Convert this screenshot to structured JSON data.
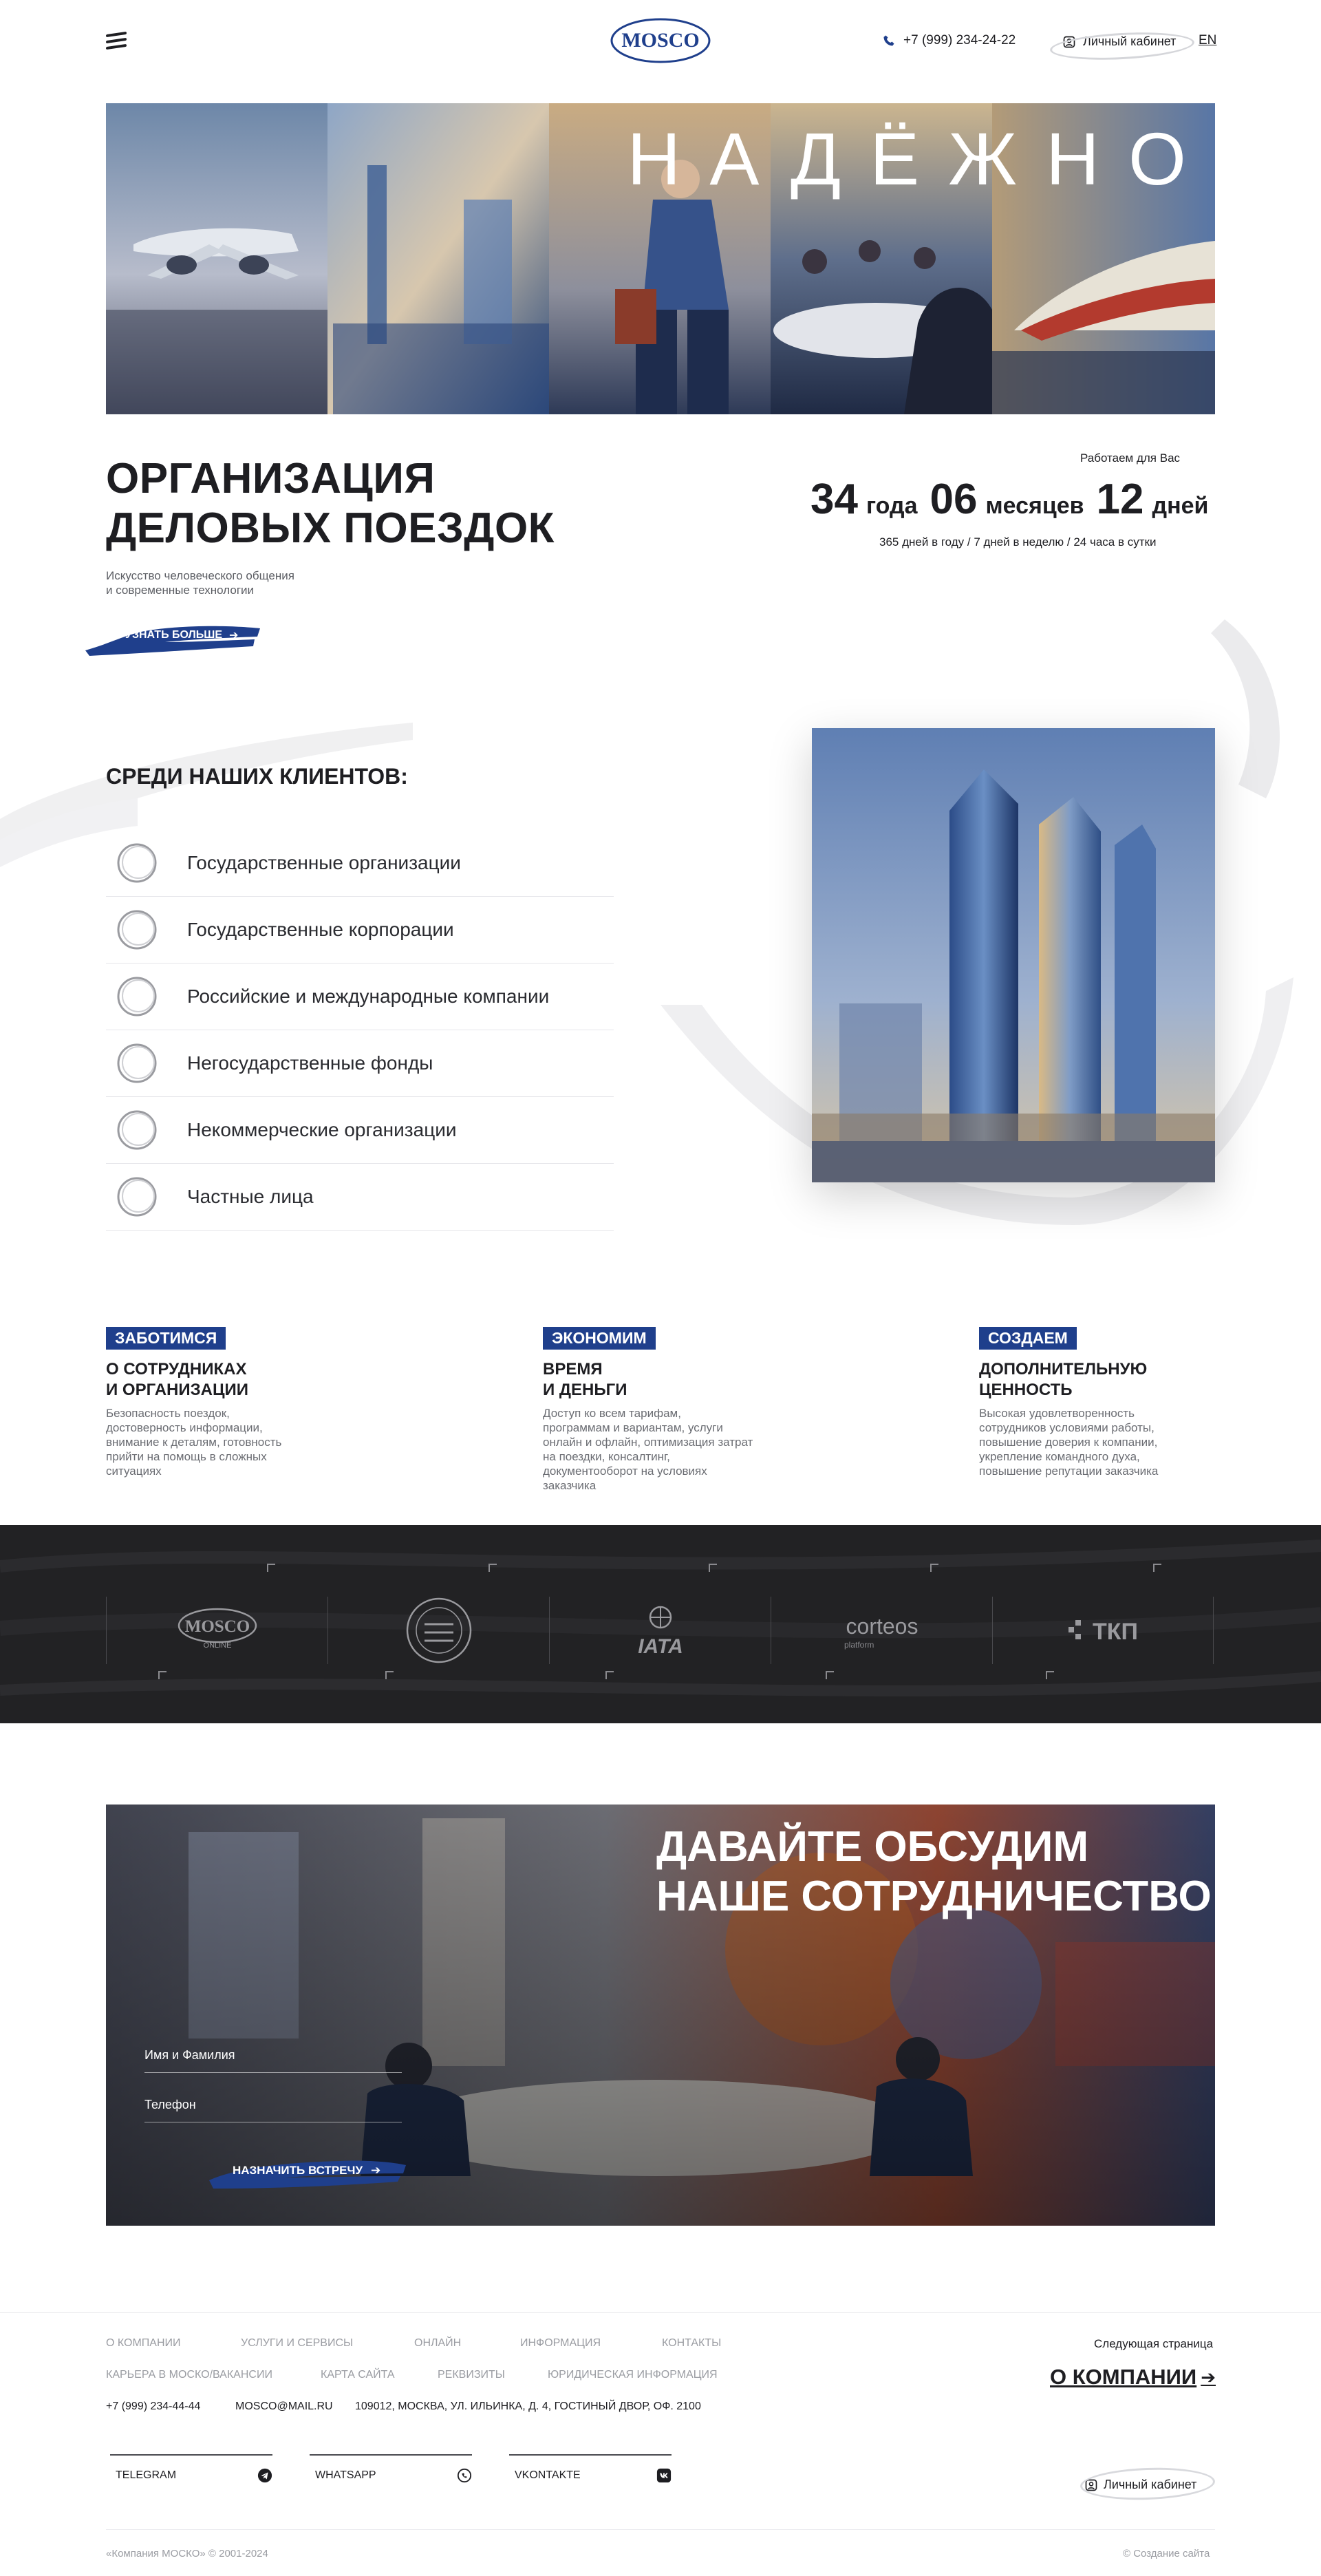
{
  "header": {
    "logo_text": "MOSCO",
    "phone": "+7 (999) 234-24-22",
    "cabinet_label": "Личный кабинет",
    "lang": "EN"
  },
  "hero": {
    "word": "НАДЁЖНО"
  },
  "intro": {
    "title_line1": "ОРГАНИЗАЦИЯ",
    "title_line2": "ДЕЛОВЫХ ПОЕЗДОК",
    "subtitle": "Искусство человеческого общения\nи современные технологии",
    "cta": "УЗНАТЬ БОЛЬШЕ"
  },
  "counter": {
    "caption": "Работаем для Вас",
    "years_value": "34",
    "years_unit": "года",
    "months_value": "06",
    "months_unit": "месяцев",
    "days_value": "12",
    "days_unit": "дней",
    "note": "365 дней в году / 7 дней в неделю / 24 часа в сутки"
  },
  "clients": {
    "title": "СРЕДИ НАШИХ КЛИЕНТОВ:",
    "items": [
      {
        "label": "Государственные организации"
      },
      {
        "label": "Государственные корпорации"
      },
      {
        "label": "Российские и международные компании"
      },
      {
        "label": "Негосударственные фонды"
      },
      {
        "label": "Некоммерческие организации"
      },
      {
        "label": "Частные лица"
      }
    ]
  },
  "features": [
    {
      "badge": "ЗАБОТИМСЯ",
      "head": "О СОТРУДНИКАХ\nИ ОРГАНИЗАЦИИ",
      "desc": "Безопасность поездок,\nдостоверность информации,\nвнимание к деталям, готовность\nприйти на помощь в сложных\nситуациях"
    },
    {
      "badge": "ЭКОНОМИМ",
      "head": "ВРЕМЯ\nИ ДЕНЬГИ",
      "desc": "Доступ ко всем тарифам,\nпрограммам и вариантам, услуги\nонлайн и офлайн, оптимизация затрат\nна поездки, консалтинг,\nдокументооборот на условиях\nзаказчика"
    },
    {
      "badge": "СОЗДАЕМ",
      "head": "ДОПОЛНИТЕЛЬНУЮ\nЦЕННОСТЬ",
      "desc": "Высокая удовлетворенность\nсотрудников условиями работы,\nповышение доверия к компании,\nукрепление командного духа,\nповышение репутации заказчика"
    }
  ],
  "partners": {
    "mosco_online_main": "MOSCO",
    "mosco_online_sub": "ONLINE",
    "iata": "IATA",
    "corteos_main": "corteos",
    "corteos_sub": "platform",
    "tkp": "ТКП"
  },
  "contact": {
    "title": "ДАВАЙТЕ ОБСУДИМ\nНАШЕ СОТРУДНИЧЕСТВО",
    "name_placeholder": "Имя и Фамилия",
    "phone_placeholder": "Телефон",
    "submit": "НАЗНАЧИТЬ ВСТРЕЧУ"
  },
  "footer": {
    "nav": [
      {
        "label": "О КОМПАНИИ"
      },
      {
        "label": "УСЛУГИ И СЕРВИСЫ"
      },
      {
        "label": "ОНЛАЙН"
      },
      {
        "label": "ИНФОРМАЦИЯ"
      },
      {
        "label": "КОНТАКТЫ"
      }
    ],
    "nav2": [
      {
        "label": "КАРЬЕРА В МОСКО/ВАКАНСИИ"
      },
      {
        "label": "КАРТА САЙТА"
      },
      {
        "label": "РЕКВИЗИТЫ"
      },
      {
        "label": "ЮРИДИЧЕСКАЯ ИНФОРМАЦИЯ"
      }
    ],
    "phone": "+7 (999) 234-44-44",
    "email": "MOSCO@MAIL.RU",
    "address": "109012, МОСКВА, УЛ. ИЛЬИНКА, Д. 4, ГОСТИНЫЙ ДВОР, ОФ. 2100",
    "next_caption": "Следующая страница",
    "next_link": "О КОМПАНИИ",
    "socials": [
      {
        "label": "TELEGRAM",
        "icon": "telegram-icon"
      },
      {
        "label": "WHATSAPP",
        "icon": "whatsapp-icon"
      },
      {
        "label": "VKONTAKTE",
        "icon": "vk-icon"
      }
    ],
    "cabinet": "Личный кабинет",
    "copyright": "«Компания МОСКО» © 2001-2024",
    "made_by": "© Создание сайта"
  },
  "colors": {
    "brand_blue": "#1f3f8c",
    "dark": "#1e1e22",
    "partners_bg": "#222224"
  }
}
